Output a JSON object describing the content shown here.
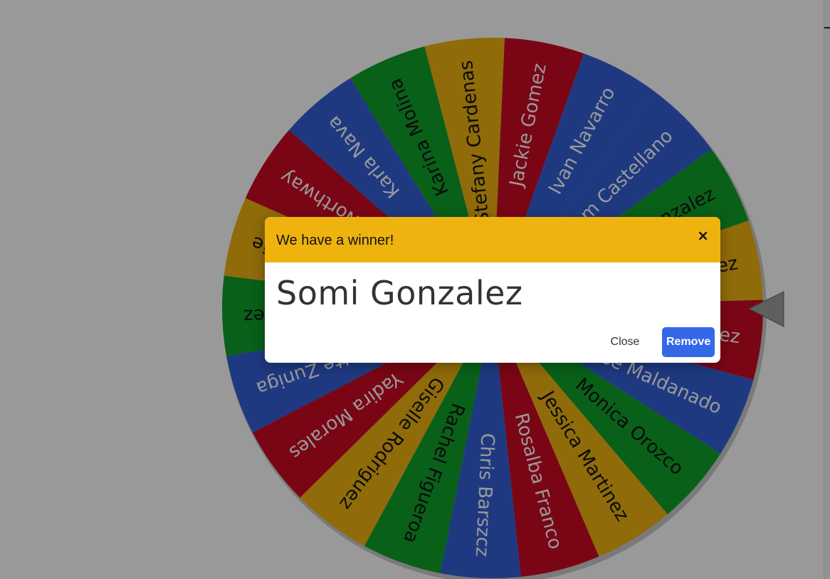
{
  "wheel": {
    "segments": [
      {
        "label": "Stefany Cardenas",
        "color": "#efb30f"
      },
      {
        "label": "Jackie Gomez",
        "color": "#cc0a24"
      },
      {
        "label": "Ivan Navarro",
        "color": "#3560d8"
      },
      {
        "label": "Miriam Castellano",
        "color": "#3560d8"
      },
      {
        "label": "Somi Gonzalez",
        "color": "#0fa02a"
      },
      {
        "label": "Somi Gonzalez",
        "color": "#efb30f"
      },
      {
        "label": "Maria Jimenez",
        "color": "#cc0a24"
      },
      {
        "label": "Yarisse Maldanado",
        "color": "#3560d8"
      },
      {
        "label": "Monica Orozco",
        "color": "#0fa02a"
      },
      {
        "label": "Jessica Martinez",
        "color": "#efb30f"
      },
      {
        "label": "Rosalba Franco",
        "color": "#cc0a24"
      },
      {
        "label": "Chris Barszcz",
        "color": "#3560d8"
      },
      {
        "label": "Rachel Figueroa",
        "color": "#0fa02a"
      },
      {
        "label": "Giselle Rodriguez",
        "color": "#efb30f"
      },
      {
        "label": "Yadira Morales",
        "color": "#cc0a24"
      },
      {
        "label": "Lizette Zuniga",
        "color": "#3560d8"
      },
      {
        "label": "Alma Alvarez",
        "color": "#0fa02a"
      },
      {
        "label": "Mary Duffie",
        "color": "#efb30f"
      },
      {
        "label": "Juana Northway",
        "color": "#cc0a24"
      },
      {
        "label": "Karla Nava",
        "color": "#3560d8"
      },
      {
        "label": "Karina Molina",
        "color": "#0fa02a"
      }
    ],
    "pointer_color": "#9e9e9e"
  },
  "modal": {
    "title": "We have a winner!",
    "close_icon": "×",
    "winner": "Somi Gonzalez",
    "close_label": "Close",
    "remove_label": "Remove",
    "header_color": "#efb30f",
    "remove_color": "#3568e8"
  }
}
